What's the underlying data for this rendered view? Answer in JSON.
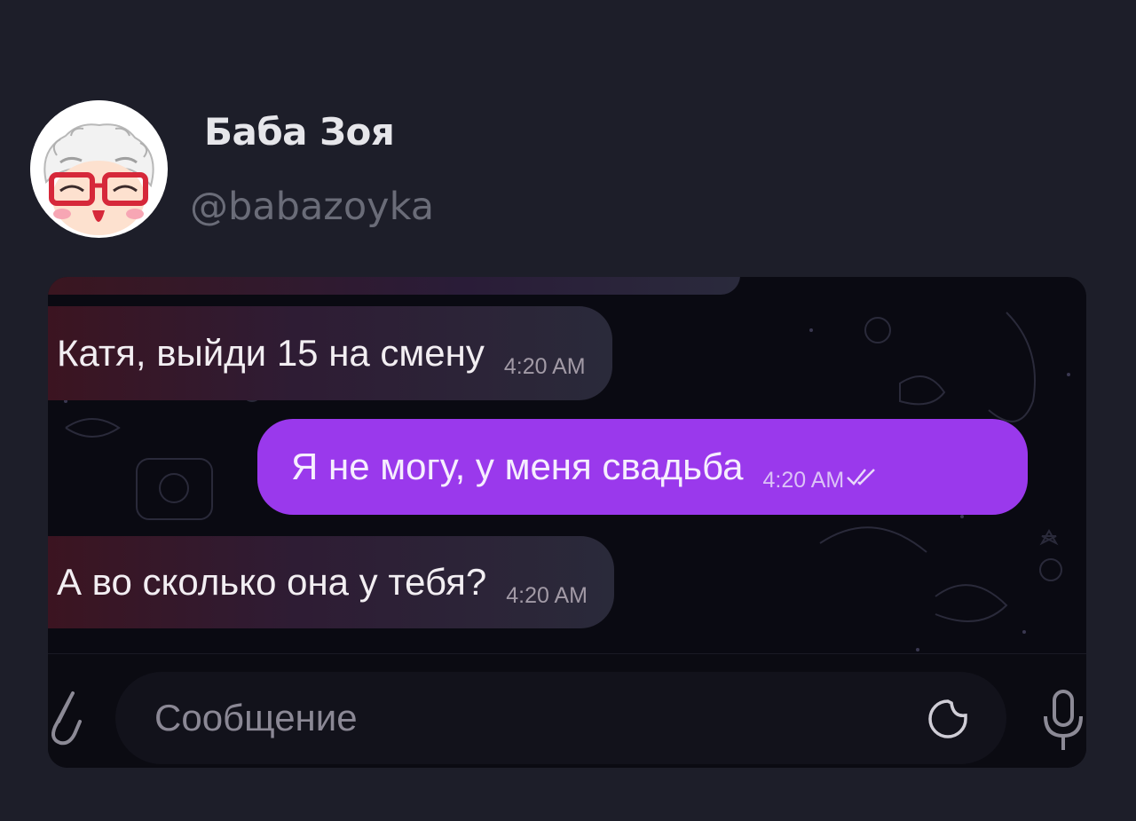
{
  "post": {
    "author_name": "Баба Зоя",
    "author_handle": "@babazoyka"
  },
  "chat": {
    "messages": [
      {
        "direction": "incoming",
        "text": "Катя, выйди 15 на смену",
        "time": "4:20 AM"
      },
      {
        "direction": "outgoing",
        "text": "Я не могу, у меня свадьба",
        "time": "4:20 AM",
        "status": "read"
      },
      {
        "direction": "incoming",
        "text": "А во сколько она у тебя?",
        "time": "4:20 AM"
      }
    ],
    "composer": {
      "placeholder": "Сообщение"
    }
  },
  "icons": {
    "attach": "paperclip-icon",
    "sticker": "sticker-icon",
    "voice": "microphone-icon",
    "read_status": "double-check-icon"
  },
  "colors": {
    "page_background": "#1d1e29",
    "outgoing_bubble": "#9a39ec",
    "incoming_bubble": "#2e1c34"
  }
}
